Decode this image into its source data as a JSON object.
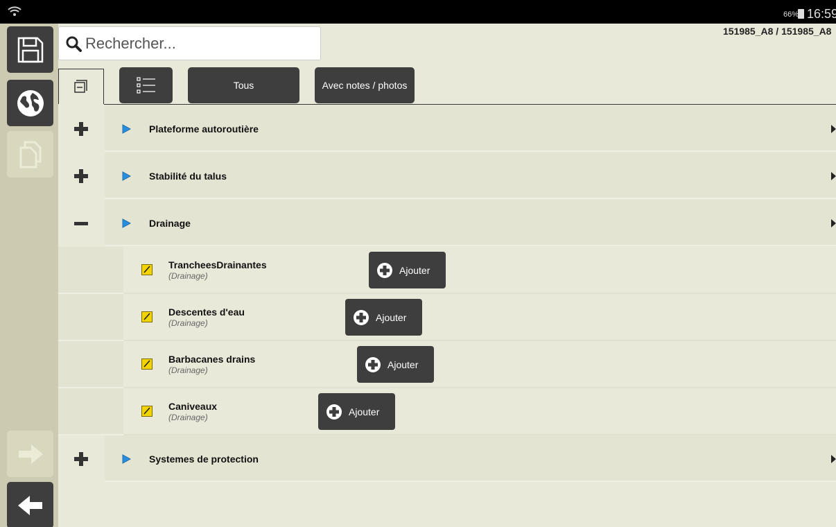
{
  "status_bar": {
    "battery": "66%",
    "time": "16:59"
  },
  "search": {
    "placeholder": "Rechercher..."
  },
  "project": "151985_A8 / 151985_A8",
  "toolbar": {
    "all_label": "Tous",
    "notes_label": "Avec notes / photos"
  },
  "categories": [
    {
      "label": "Plateforme autoroutière",
      "expanded": false
    },
    {
      "label": "Stabilité du talus",
      "expanded": false
    },
    {
      "label": "Drainage",
      "expanded": true
    },
    {
      "label": "Systemes de protection",
      "expanded": false
    }
  ],
  "items": [
    {
      "title": "TrancheesDrainantes",
      "subtitle": "(Drainage)",
      "add_label": "Ajouter"
    },
    {
      "title": "Descentes d'eau",
      "subtitle": "(Drainage)",
      "add_label": "Ajouter"
    },
    {
      "title": "Barbacanes drains",
      "subtitle": "(Drainage)",
      "add_label": "Ajouter"
    },
    {
      "title": "Caniveaux",
      "subtitle": "(Drainage)",
      "add_label": "Ajouter"
    }
  ],
  "colors": {
    "background": "#e9e9d9",
    "sidebar": "#cccbb1",
    "button": "#3e3e3e",
    "triangle_accent": "#2a8ee0",
    "pencil_icon": "#f2d400"
  }
}
